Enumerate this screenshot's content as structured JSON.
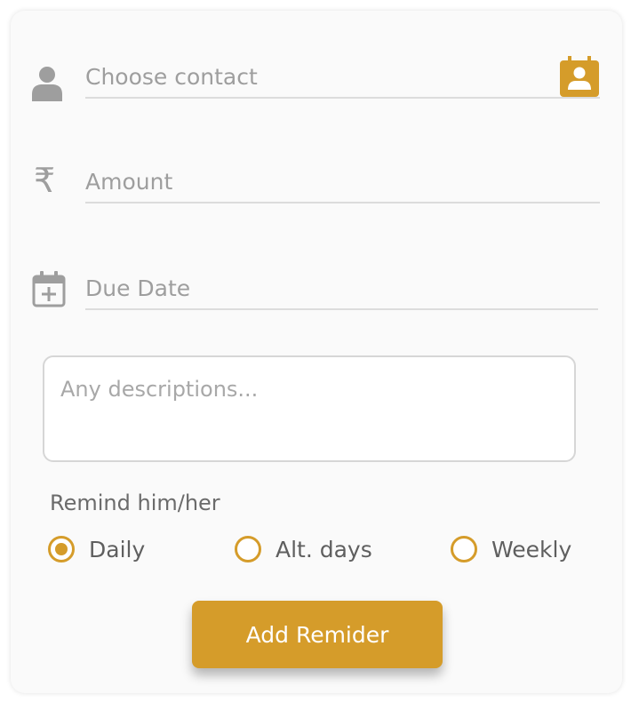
{
  "colors": {
    "accent": "#d59c2a",
    "icon_gray": "#9e9e9e",
    "underline": "#dcdcdc"
  },
  "form": {
    "contact": {
      "placeholder": "Choose contact",
      "icon": "person-icon",
      "picker_icon": "contact-book-icon"
    },
    "amount": {
      "placeholder": "Amount",
      "icon": "rupee-icon"
    },
    "due_date": {
      "placeholder": "Due Date",
      "icon": "calendar-add-icon"
    },
    "description": {
      "placeholder": "Any descriptions..."
    },
    "remind": {
      "label": "Remind him/her",
      "options": [
        {
          "label": "Daily",
          "selected": true
        },
        {
          "label": "Alt. days",
          "selected": false
        },
        {
          "label": "Weekly",
          "selected": false
        }
      ]
    },
    "submit_label": "Add Remider"
  }
}
